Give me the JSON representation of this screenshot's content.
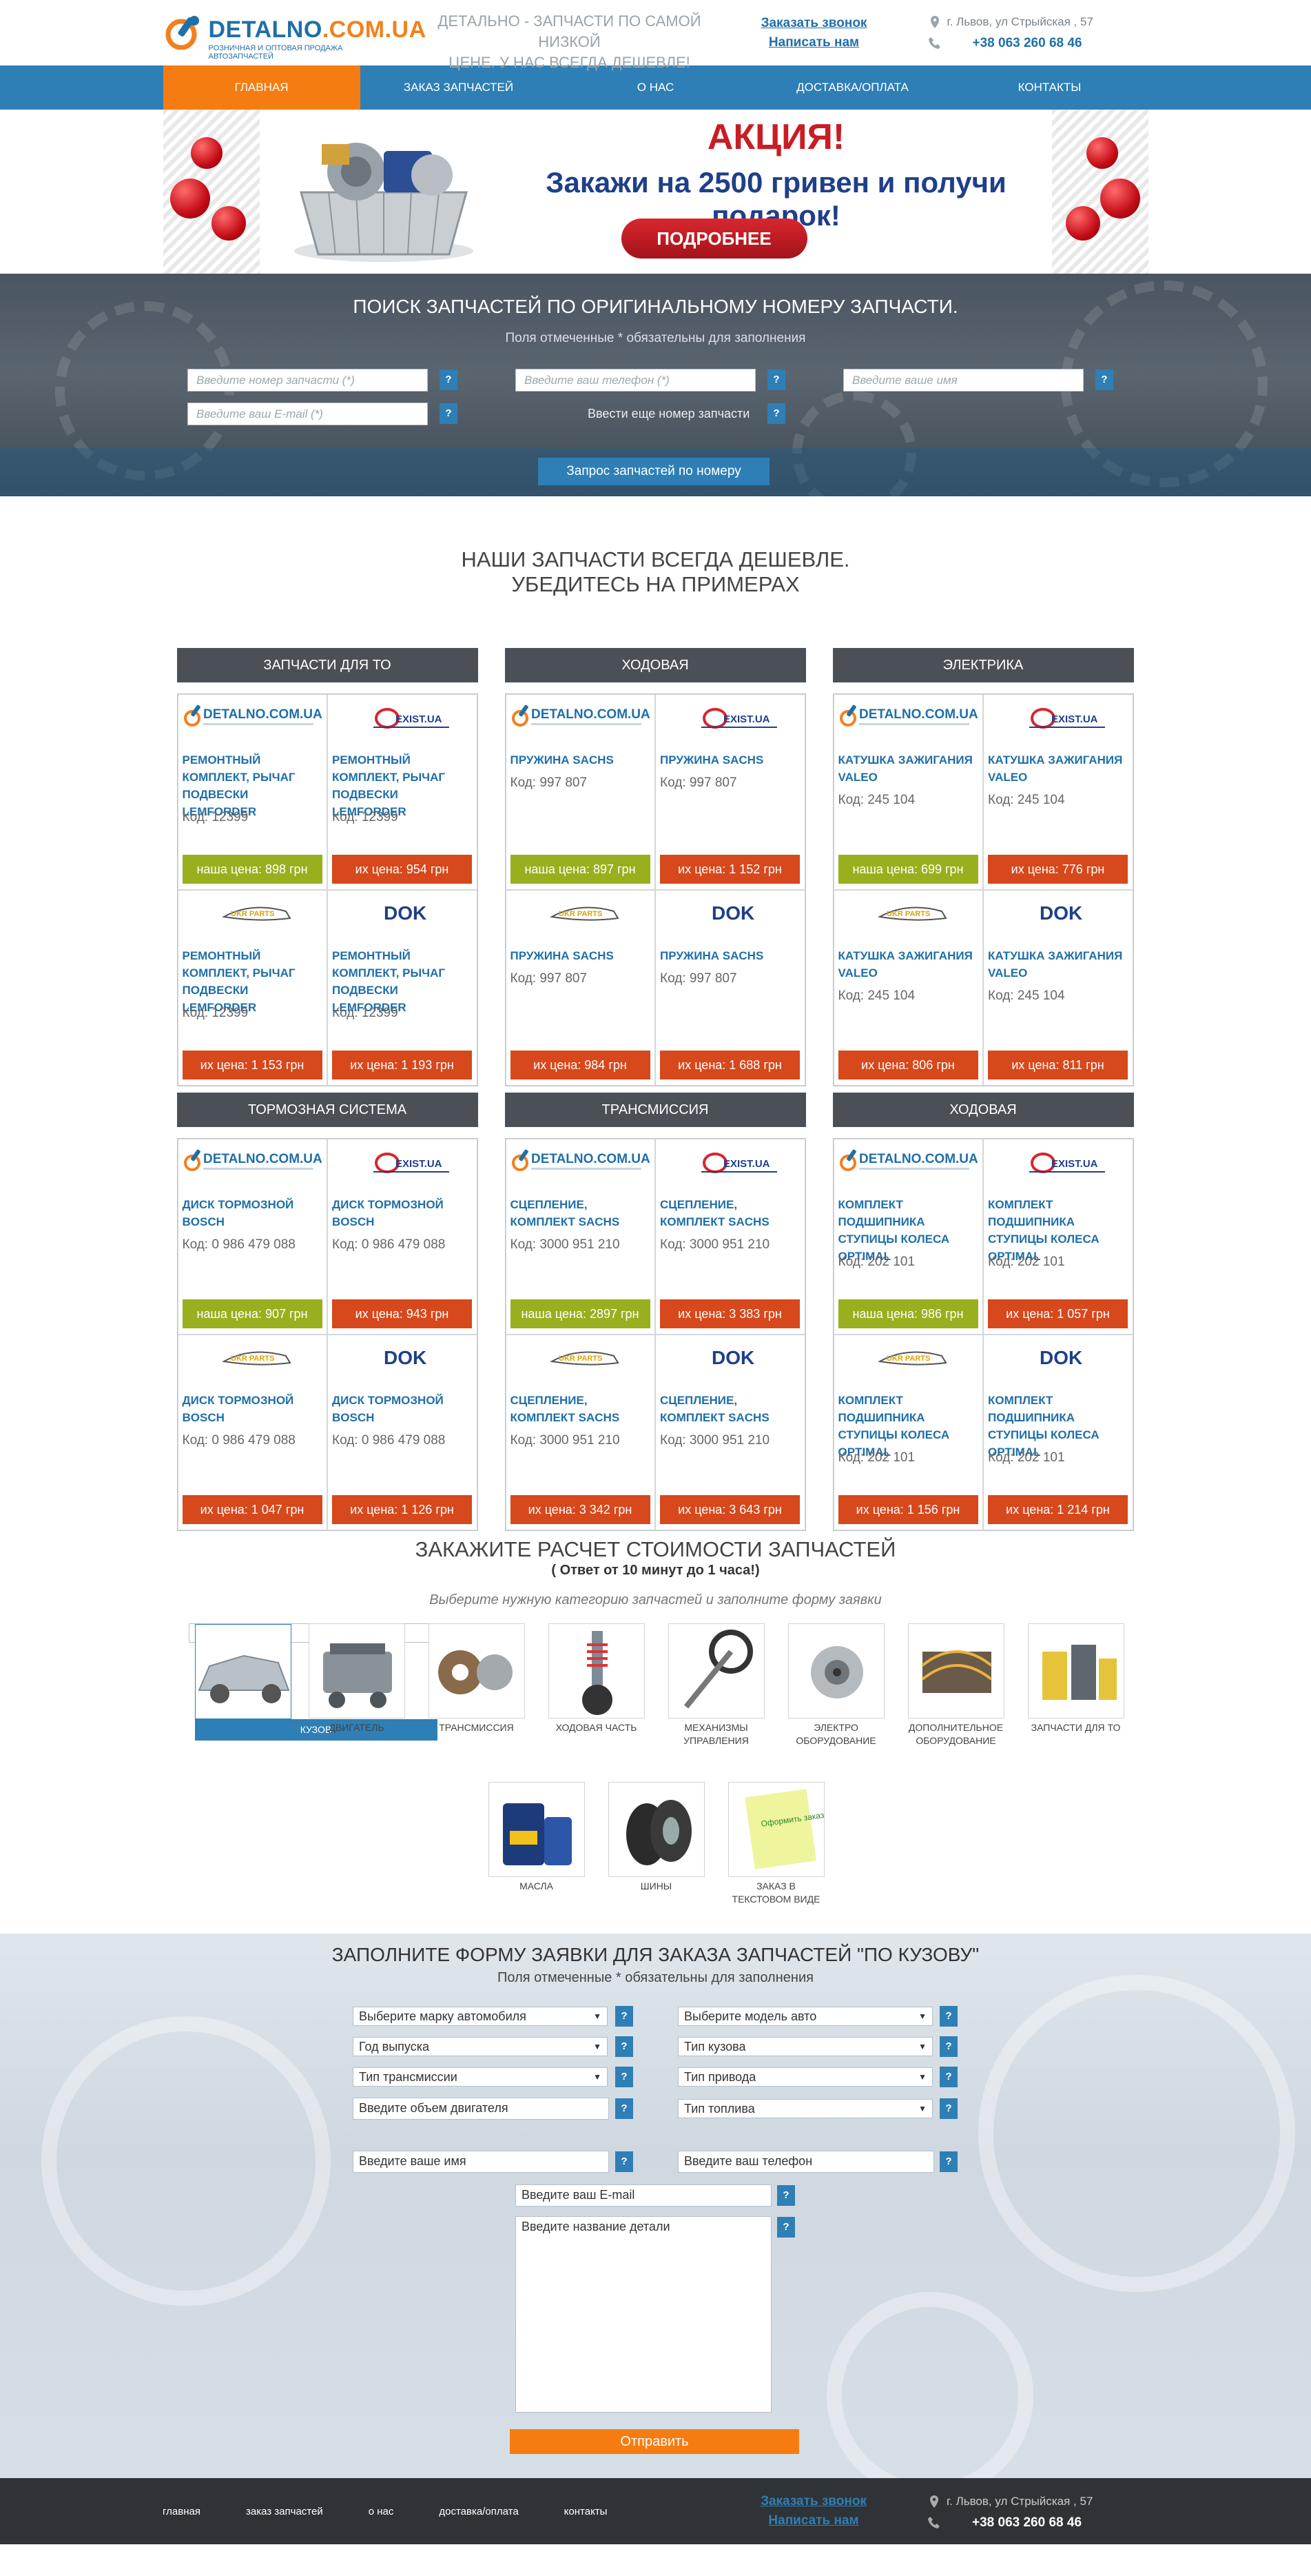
{
  "header": {
    "logo_name_main": "DETALNO",
    "logo_name_domain": ".COM.UA",
    "logo_tagline": "РОЗНИЧНАЯ И ОПТОВАЯ ПРОДАЖА АВТОЗАПЧАСТЕЙ",
    "slogan_line1": "ДЕТАЛЬНО - ЗАПЧАСТИ ПО САМОЙ НИЗКОЙ",
    "slogan_line2": "ЦЕНЕ. У НАС ВСЕГДА ДЕШЕВЛЕ!",
    "call_link": "Заказать звонок",
    "write_link": "Написать нам",
    "address": "г. Львов, ул Стрыйская , 57",
    "phone": "+38 063 260 68 46"
  },
  "nav": {
    "items": [
      {
        "label": "ГЛАВНАЯ"
      },
      {
        "label": "ЗАКАЗ ЗАПЧАСТЕЙ"
      },
      {
        "label": "О НАС"
      },
      {
        "label": "ДОСТАВКА/ОПЛАТА"
      },
      {
        "label": "КОНТАКТЫ"
      }
    ],
    "active_index": 0
  },
  "banner": {
    "title": "АКЦИЯ!",
    "offer": "Закажи на 2500 гривен и получи подарок!",
    "button": "ПОДРОБНЕЕ"
  },
  "search": {
    "title": "ПОИСК ЗАПЧАСТЕЙ ПО ОРИГИНАЛЬНОМУ НОМЕРУ ЗАПЧАСТИ.",
    "note": "Поля отмеченные * обязательны для заполнения",
    "part_number_placeholder": "Введите номер запчасти (*)",
    "phone_placeholder": "Введите ваш телефон (*)",
    "name_placeholder": "Введите ваше имя",
    "email_placeholder": "Введите ваш E-mail (*)",
    "more_number": "Ввести еще номер запчасти",
    "help": "?",
    "submit": "Запрос запчастей по номеру"
  },
  "examples": {
    "title_line1": "НАШИ ЗАПЧАСТИ ВСЕГДА ДЕШЕВЛЕ.",
    "title_line2": "УБЕДИТЕСЬ НА ПРИМЕРАХ",
    "logo_detalno": "DETALNO.COM.UA",
    "logo_exist": "EXIST.UA",
    "logo_ukr": "UKR PARTS",
    "logo_dok": "DOK",
    "categories": [
      {
        "name": "ЗАПЧАСТИ ДЛЯ ТО",
        "cells": [
          {
            "logo": "detalno",
            "part": "РЕМОНТНЫЙ КОМПЛЕКТ, РЫЧАГ ПОДВЕСКИ LEMFORDER",
            "code": "Код: 12399",
            "price": "наша цена: 898 грн",
            "ours": true
          },
          {
            "logo": "exist",
            "part": "РЕМОНТНЫЙ КОМПЛЕКТ, РЫЧАГ ПОДВЕСКИ LEMFORDER",
            "code": "Код: 12399",
            "price": "их цена: 954 грн",
            "ours": false
          },
          {
            "logo": "ukr",
            "part": "РЕМОНТНЫЙ КОМПЛЕКТ, РЫЧАГ ПОДВЕСКИ LEMFORDER",
            "code": "Код: 12399",
            "price": "их цена: 1 153 грн",
            "ours": false
          },
          {
            "logo": "dok",
            "part": "РЕМОНТНЫЙ КОМПЛЕКТ, РЫЧАГ ПОДВЕСКИ LEMFORDER",
            "code": "Код: 12399",
            "price": "их цена: 1 193 грн",
            "ours": false
          }
        ]
      },
      {
        "name": "ХОДОВАЯ",
        "cells": [
          {
            "logo": "detalno",
            "part": "ПРУЖИНА SACHS",
            "code": "Код: 997 807",
            "price": "наша цена: 897 грн",
            "ours": true
          },
          {
            "logo": "exist",
            "part": "ПРУЖИНА SACHS",
            "code": "Код: 997 807",
            "price": "их цена: 1 152 грн",
            "ours": false
          },
          {
            "logo": "ukr",
            "part": "ПРУЖИНА SACHS",
            "code": "Код: 997 807",
            "price": "их цена: 984 грн",
            "ours": false
          },
          {
            "logo": "dok",
            "part": "ПРУЖИНА SACHS",
            "code": "Код: 997 807",
            "price": "их цена: 1 688 грн",
            "ours": false
          }
        ]
      },
      {
        "name": "ЭЛЕКТРИКА",
        "cells": [
          {
            "logo": "detalno",
            "part": "КАТУШКА ЗАЖИГАНИЯ VALEO",
            "code": "Код: 245 104",
            "price": "наша цена: 699 грн",
            "ours": true
          },
          {
            "logo": "exist",
            "part": "КАТУШКА ЗАЖИГАНИЯ VALEO",
            "code": "Код: 245 104",
            "price": "их цена: 776 грн",
            "ours": false
          },
          {
            "logo": "ukr",
            "part": "КАТУШКА ЗАЖИГАНИЯ VALEO",
            "code": "Код: 245 104",
            "price": "их цена: 806 грн",
            "ours": false
          },
          {
            "logo": "dok",
            "part": "КАТУШКА ЗАЖИГАНИЯ VALEO",
            "code": "Код: 245 104",
            "price": "их цена: 811 грн",
            "ours": false
          }
        ]
      },
      {
        "name": "ТОРМОЗНАЯ СИСТЕМА",
        "cells": [
          {
            "logo": "detalno",
            "part": "ДИСК ТОРМОЗНОЙ BOSCH",
            "code": "Код: 0 986 479 088",
            "price": "наша цена: 907 грн",
            "ours": true
          },
          {
            "logo": "exist",
            "part": "ДИСК ТОРМОЗНОЙ BOSCH",
            "code": "Код: 0 986 479 088",
            "price": "их цена: 943 грн",
            "ours": false
          },
          {
            "logo": "ukr",
            "part": "ДИСК ТОРМОЗНОЙ BOSCH",
            "code": "Код: 0 986 479 088",
            "price": "их цена: 1 047 грн",
            "ours": false
          },
          {
            "logo": "dok",
            "part": "ДИСК ТОРМОЗНОЙ BOSCH",
            "code": "Код: 0 986 479 088",
            "price": "их цена: 1 126 грн",
            "ours": false
          }
        ]
      },
      {
        "name": "ТРАНСМИССИЯ",
        "cells": [
          {
            "logo": "detalno",
            "part": "СЦЕПЛЕНИЕ, КОМПЛЕКТ SACHS",
            "code": "Код: 3000 951 210",
            "price": "наша цена: 2897 грн",
            "ours": true
          },
          {
            "logo": "exist",
            "part": "СЦЕПЛЕНИЕ, КОМПЛЕКТ SACHS",
            "code": "Код: 3000 951 210",
            "price": "их цена: 3 383 грн",
            "ours": false
          },
          {
            "logo": "ukr",
            "part": "СЦЕПЛЕНИЕ, КОМПЛЕКТ SACHS",
            "code": "Код: 3000 951 210",
            "price": "их цена: 3 342 грн",
            "ours": false
          },
          {
            "logo": "dok",
            "part": "СЦЕПЛЕНИЕ, КОМПЛЕКТ SACHS",
            "code": "Код: 3000 951 210",
            "price": "их цена: 3 643 грн",
            "ours": false
          }
        ]
      },
      {
        "name": "ХОДОВАЯ",
        "cells": [
          {
            "logo": "detalno",
            "part": "КОМПЛЕКТ ПОДШИПНИКА СТУПИЦЫ КОЛЕСА OPTIMAL",
            "code": "Код: 202 101",
            "price": "наша цена: 986 грн",
            "ours": true
          },
          {
            "logo": "exist",
            "part": "КОМПЛЕКТ ПОДШИПНИКА СТУПИЦЫ КОЛЕСА OPTIMAL",
            "code": "Код: 202 101",
            "price": "их цена: 1 057 грн",
            "ours": false
          },
          {
            "logo": "ukr",
            "part": "КОМПЛЕКТ ПОДШИПНИКА СТУПИЦЫ КОЛЕСА OPTIMAL",
            "code": "Код: 202 101",
            "price": "их цена: 1 156 грн",
            "ours": false
          },
          {
            "logo": "dok",
            "part": "КОМПЛЕКТ ПОДШИПНИКА СТУПИЦЫ КОЛЕСА OPTIMAL",
            "code": "Код: 202 101",
            "price": "их цена: 1 214 грн",
            "ours": false
          }
        ]
      }
    ]
  },
  "calc": {
    "title": "ЗАКАЖИТЕ РАСЧЕТ СТОИМОСТИ ЗАПЧАСТЕЙ",
    "subtitle": "( Ответ от 10 минут до 1 часа!)",
    "hint": "Выберите нужную категорию запчастей и заполните форму заявки",
    "categories": [
      {
        "label": "КУЗОВ",
        "icon": "car-body-icon"
      },
      {
        "label": "ДВИГАТЕЛЬ",
        "icon": "engine-icon"
      },
      {
        "label": "ТРАНСМИССИЯ",
        "icon": "transmission-icon"
      },
      {
        "label": "ХОДОВАЯ ЧАСТЬ",
        "icon": "suspension-icon"
      },
      {
        "label": "МЕХАНИЗМЫ УПРАВЛЕНИЯ",
        "icon": "steering-icon"
      },
      {
        "label": "ЭЛЕКТРО ОБОРУДОВАНИЕ",
        "icon": "alternator-icon"
      },
      {
        "label": "ДОПОЛНИТЕЛЬНОЕ ОБОРУДОВАНИЕ",
        "icon": "wiring-icon"
      },
      {
        "label": "ЗАПЧАСТИ ДЛЯ ТО",
        "icon": "filters-icon"
      },
      {
        "label": "МАСЛА",
        "icon": "oil-icon"
      },
      {
        "label": "ШИНЫ",
        "icon": "tires-icon"
      },
      {
        "label": "ЗАКАЗ В ТЕКСТОВОМ ВИДЕ",
        "icon": "note-icon"
      }
    ],
    "note_sticker": "Оформить заказ"
  },
  "order": {
    "title": "ЗАПОЛНИТЕ ФОРМУ ЗАЯВКИ ДЛЯ ЗАКАЗА ЗАПЧАСТЕЙ \"ПО КУЗОВУ\"",
    "note": "Поля отмеченные * обязательны для заполнения",
    "brand": "Выберите марку автомобиля",
    "model": "Выберите модель авто",
    "year": "Год выпуска",
    "body": "Тип кузова",
    "transmission": "Тип трансмиссии",
    "drive": "Тип привода",
    "engine_volume": "Введите объем двигателя",
    "fuel": "Тип топлива",
    "name": "Введите ваше имя",
    "phone": "Введите ваш телефон",
    "email": "Введите ваш E-mail",
    "detail": "Введите название детали",
    "help": "?",
    "submit": "Отправить"
  },
  "footer": {
    "links": [
      "главная",
      "заказ запчастей",
      "о нас",
      "доставка/оплата",
      "контакты"
    ],
    "call_link": "Заказать звонок",
    "write_link": "Написать нам",
    "address": "г. Львов, ул Стрыйская , 57",
    "phone": "+38 063 260 68 46"
  },
  "colors": {
    "brand_blue": "#2e7fb5",
    "brand_orange": "#f57c10",
    "our_price": "#9aaf1e",
    "their_price": "#d7481c",
    "dark_header": "#4a5056"
  }
}
